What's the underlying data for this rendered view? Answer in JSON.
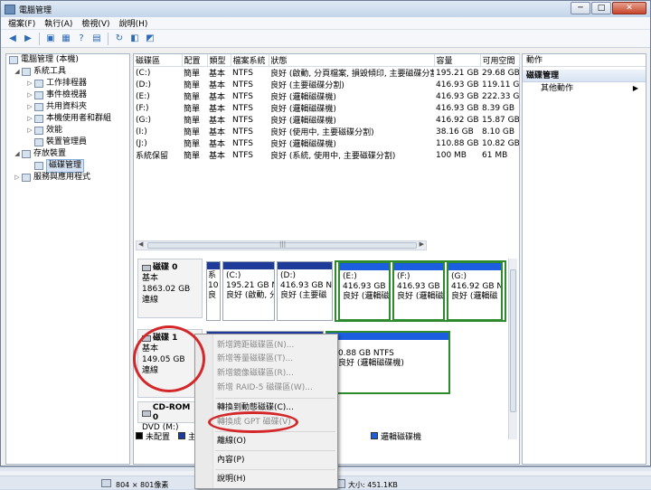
{
  "window": {
    "title": "電腦管理",
    "buttons": [
      "─",
      "□",
      "✕"
    ]
  },
  "menu": [
    "檔案(F)",
    "執行(A)",
    "檢視(V)",
    "說明(H)"
  ],
  "tree": [
    {
      "label": "電腦管理 (本機)",
      "indent": 0,
      "exp": ""
    },
    {
      "label": "系統工具",
      "indent": 1,
      "exp": "◢"
    },
    {
      "label": "工作排程器",
      "indent": 2,
      "exp": "▷"
    },
    {
      "label": "事件檢視器",
      "indent": 2,
      "exp": "▷"
    },
    {
      "label": "共用資料夾",
      "indent": 2,
      "exp": "▷"
    },
    {
      "label": "本機使用者和群組",
      "indent": 2,
      "exp": "▷"
    },
    {
      "label": "效能",
      "indent": 2,
      "exp": "▷"
    },
    {
      "label": "裝置管理員",
      "indent": 2,
      "exp": ""
    },
    {
      "label": "存放裝置",
      "indent": 1,
      "exp": "◢"
    },
    {
      "label": "磁碟管理",
      "indent": 2,
      "exp": "",
      "selected": true
    },
    {
      "label": "服務與應用程式",
      "indent": 1,
      "exp": "▷"
    }
  ],
  "volume_table": {
    "headers": [
      "磁碟區",
      "配置",
      "類型",
      "檔案系統",
      "狀態",
      "容量",
      "可用空間"
    ],
    "rows": [
      [
        "(C:)",
        "簡單",
        "基本",
        "NTFS",
        "良好 (啟動, 分頁檔案, 損毀傾印, 主要磁碟分割)",
        "195.21 GB",
        "29.68 GB"
      ],
      [
        "(D:)",
        "簡單",
        "基本",
        "NTFS",
        "良好 (主要磁碟分割)",
        "416.93 GB",
        "119.11 GB"
      ],
      [
        "(E:)",
        "簡單",
        "基本",
        "NTFS",
        "良好 (邏輯磁碟機)",
        "416.93 GB",
        "222.33 GB"
      ],
      [
        "(F:)",
        "簡單",
        "基本",
        "NTFS",
        "良好 (邏輯磁碟機)",
        "416.93 GB",
        "8.39 GB"
      ],
      [
        "(G:)",
        "簡單",
        "基本",
        "NTFS",
        "良好 (邏輯磁碟機)",
        "416.92 GB",
        "15.87 GB"
      ],
      [
        "(I:)",
        "簡單",
        "基本",
        "NTFS",
        "良好 (使用中, 主要磁碟分割)",
        "38.16 GB",
        "8.10 GB"
      ],
      [
        "(J:)",
        "簡單",
        "基本",
        "NTFS",
        "良好 (邏輯磁碟機)",
        "110.88 GB",
        "10.82 GB"
      ],
      [
        "系統保留",
        "簡單",
        "基本",
        "NTFS",
        "良好 (系統, 使用中, 主要磁碟分割)",
        "100 MB",
        "61 MB"
      ]
    ]
  },
  "disk0": {
    "name": "磁碟 0",
    "type": "基本",
    "size": "1863.02 GB",
    "status": "連線",
    "parts": [
      {
        "l1": "系",
        "l2": "10",
        "l3": "良"
      },
      {
        "l1": "(C:)",
        "l2": "195.21 GB N",
        "l3": "良好 (啟動, 分"
      },
      {
        "l1": "(D:)",
        "l2": "416.93 GB N",
        "l3": "良好 (主要磁"
      },
      {
        "l1": "(E:)",
        "l2": "416.93 GB NT",
        "l3": "良好 (邏輯磁碟"
      },
      {
        "l1": "(F:)",
        "l2": "416.93 GB NT",
        "l3": "良好 (邏輯磁碟"
      },
      {
        "l1": "(G:)",
        "l2": "416.92 GB N",
        "l3": "良好 (邏輯磁"
      }
    ]
  },
  "disk1": {
    "name": "磁碟 1",
    "type": "基本",
    "size": "149.05 GB",
    "status": "連線",
    "part_size": "0.88 GB NTFS",
    "part_status": "良好 (邏輯磁碟機)"
  },
  "cdrom": {
    "name": "CD-ROM 0",
    "drive": "DVD (M:)"
  },
  "legend": [
    {
      "label": "未配置",
      "color": "#000000"
    },
    {
      "label": "主",
      "color": "#1e3b9a"
    },
    {
      "label": "邏輯磁碟機",
      "color": "#1b5ee0"
    }
  ],
  "actions": {
    "header": "動作",
    "section": "磁碟管理",
    "item": "其他動作"
  },
  "context_menu": [
    {
      "label": "新增跨距磁碟區(N)...",
      "disabled": true
    },
    {
      "label": "新增等量磁碟區(T)...",
      "disabled": true
    },
    {
      "label": "新增鏡像磁碟區(R)...",
      "disabled": true
    },
    {
      "label": "新增 RAID-5 磁碟區(W)...",
      "disabled": true
    },
    {
      "label": "轉換到動態磁碟(C)...",
      "disabled": false
    },
    {
      "label": "轉換成 GPT 磁碟(V)",
      "disabled": true
    },
    {
      "label": "離線(O)",
      "disabled": false
    },
    {
      "label": "內容(P)",
      "disabled": false
    },
    {
      "label": "說明(H)",
      "disabled": false
    }
  ],
  "statusbar": {
    "dims": "804 × 801像素",
    "size": "大小: 451.1KB"
  },
  "colors": {
    "annotation": "#d3272a",
    "primary_partition": "#1e3b9a",
    "logical_drive": "#1b5ee0",
    "extended_border": "#2d8a2d"
  }
}
